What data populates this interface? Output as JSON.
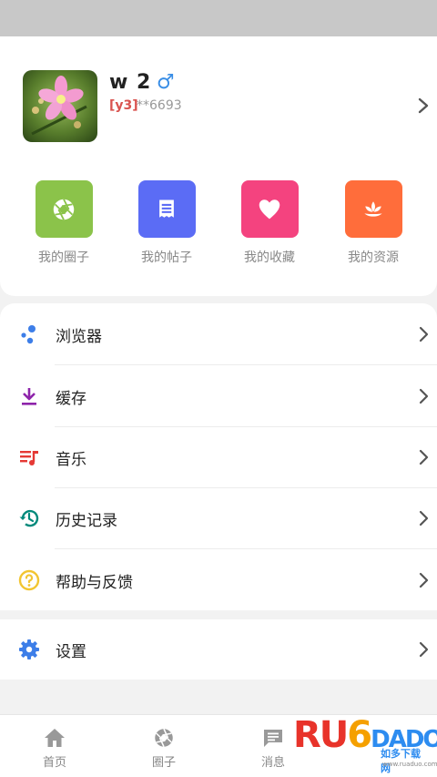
{
  "profile": {
    "name": "w 2",
    "gender_symbol": "♂",
    "level": "[y3]",
    "user_id": "**6693"
  },
  "quick_actions": [
    {
      "label": "我的圈子",
      "icon": "aperture-icon",
      "color": "#8bc34a"
    },
    {
      "label": "我的帖子",
      "icon": "document-icon",
      "color": "#5b6cf5"
    },
    {
      "label": "我的收藏",
      "icon": "heart-icon",
      "color": "#f4437f"
    },
    {
      "label": "我的资源",
      "icon": "lotus-icon",
      "color": "#ff6d3b"
    }
  ],
  "menu": {
    "items": [
      {
        "label": "浏览器",
        "icon": "browser-dots-icon",
        "color": "#3d7ee8"
      },
      {
        "label": "缓存",
        "icon": "download-icon",
        "color": "#8e24aa"
      },
      {
        "label": "音乐",
        "icon": "music-list-icon",
        "color": "#e53935"
      },
      {
        "label": "历史记录",
        "icon": "history-icon",
        "color": "#00897b"
      },
      {
        "label": "帮助与反馈",
        "icon": "help-icon",
        "color": "#f2c531"
      }
    ],
    "settings_label": "设置",
    "settings_icon": "gear-icon",
    "settings_color": "#3d7ee8"
  },
  "tabs": [
    {
      "label": "首页",
      "icon": "home-icon"
    },
    {
      "label": "圈子",
      "icon": "aperture-icon"
    },
    {
      "label": "消息",
      "icon": "message-icon"
    }
  ],
  "watermark": {
    "word_r": "RU",
    "word_o": "6",
    "word_rest": "DADO",
    "subtitle": "如多下载网",
    "url": "www.ruaduo.com"
  }
}
